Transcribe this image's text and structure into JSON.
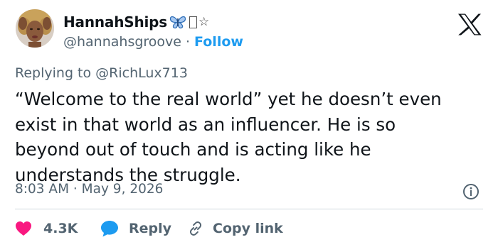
{
  "author": {
    "display_name": "HannahShips",
    "name_suffix_star": "☆",
    "handle": "@hannahsgroove",
    "separator": "·",
    "follow_label": "Follow"
  },
  "platform_logo": "x-logo",
  "reply_to": "Replying to @RichLux713",
  "tweet": {
    "text": "“Welcome to the real world” yet he doesn’t even\nexist in that world as an influencer. He is so\nbeyond out of touch and is acting like he\nunderstands the struggle."
  },
  "timestamp": "8:03 AM · May 9, 2026",
  "actions": {
    "like_count": "4.3K",
    "reply_label": "Reply",
    "copy_link_label": "Copy link"
  },
  "icons": {
    "header": [
      "butterfly-emoji",
      "x-logo-icon",
      "info-icon"
    ],
    "actions": [
      "heart-icon",
      "reply-bubble-icon",
      "link-icon"
    ]
  },
  "colors": {
    "link_blue": "#1d9bf0",
    "like_pink": "#f91880",
    "secondary_text": "#536471",
    "primary_text": "#0f1419",
    "divider": "#cfd9de",
    "butterfly_blue": "#4a90d9"
  }
}
